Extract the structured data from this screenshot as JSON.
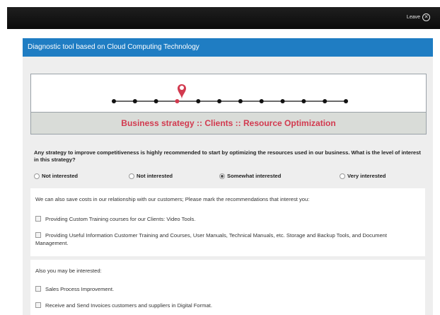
{
  "topbar": {
    "leave_label": "Leave",
    "close_icon": "✕"
  },
  "panel": {
    "title": "Diagnostic tool based on Cloud Computing Technology"
  },
  "progress": {
    "current_step": 4,
    "total_steps": 12,
    "accent_color": "#d23a4f",
    "stage_title": "Business strategy :: Clients :: Resource Optimization"
  },
  "question": {
    "text": "Any strategy to improve competitiveness is highly recommended to start by optimizing the resources used in our business. What is the level of interest in this strategy?",
    "options": [
      {
        "label": "Not interested",
        "checked": false
      },
      {
        "label": "Not interested",
        "checked": false
      },
      {
        "label": "Somewhat interested",
        "checked": true
      },
      {
        "label": "Very interested",
        "checked": false
      }
    ]
  },
  "section1": {
    "intro": "We can also save costs in our relationship with our customers; Please mark the recommendations that interest you:",
    "items": [
      "Providing Custom Training courses for our Clients: Video Tools.",
      "Providing Useful Information Customer Training and Courses, User Manuals, Technical Manuals, etc. Storage and Backup Tools, and Document Management."
    ]
  },
  "section2": {
    "intro": "Also you may be interested:",
    "items": [
      "Sales Process Improvement.",
      "Receive and Send Invoices customers and suppliers in Digital Format."
    ]
  }
}
